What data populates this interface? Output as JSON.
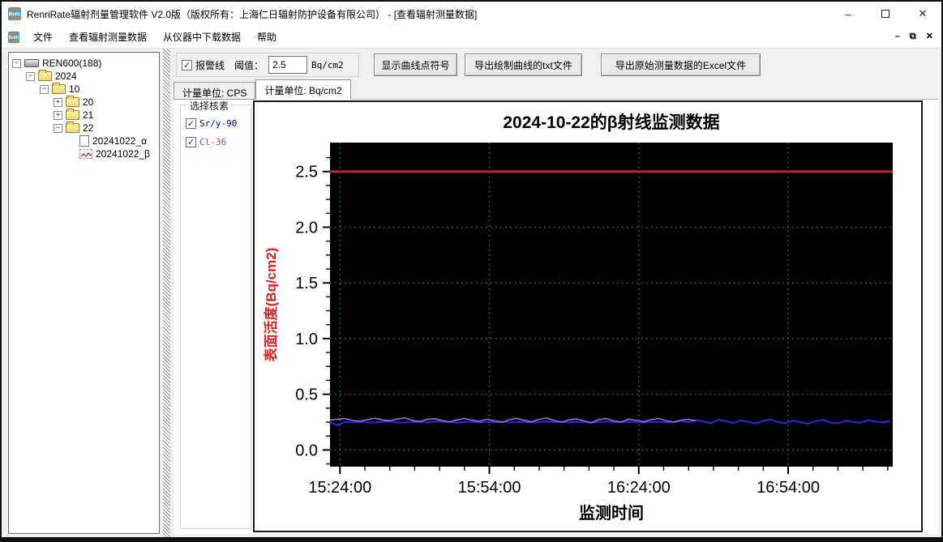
{
  "window": {
    "title": "RenriRate辐射剂量管理软件 V2.0版（版权所有：上海仁日辐射防护设备有限公司） - [查看辐射测量数据]",
    "controls": {
      "minimize": "–",
      "maximize": "",
      "close": "✕"
    }
  },
  "menu": {
    "items": [
      "文件",
      "查看辐射测量数据",
      "从仪器中下载数据",
      "帮助"
    ],
    "mdi_controls": {
      "minimize": "–",
      "restore": "⧉",
      "close": "✕"
    }
  },
  "tree": {
    "items": [
      {
        "label": "REN600(188)",
        "depth": 0,
        "icon": "device",
        "expander": "−"
      },
      {
        "label": "2024",
        "depth": 1,
        "icon": "folder",
        "expander": "−"
      },
      {
        "label": "10",
        "depth": 2,
        "icon": "folder",
        "expander": "−"
      },
      {
        "label": "20",
        "depth": 3,
        "icon": "folder",
        "expander": "+"
      },
      {
        "label": "21",
        "depth": 3,
        "icon": "folder",
        "expander": "+"
      },
      {
        "label": "22",
        "depth": 3,
        "icon": "folder",
        "expander": "−"
      },
      {
        "label": "20241022_α",
        "depth": 4,
        "icon": "doc",
        "expander": ""
      },
      {
        "label": "20241022_β",
        "depth": 4,
        "icon": "chart",
        "expander": ""
      }
    ]
  },
  "toolbar": {
    "alarm_checkbox_label": "报警线",
    "alarm_checked": true,
    "threshold_label": "阈值：",
    "threshold_value": "2.5",
    "threshold_unit": "Bq/cm2",
    "show_points_button": "显示曲线点符号",
    "export_txt_button": "导出绘制曲线的txt文件",
    "export_excel_button": "导出原始测量数据的Excel文件"
  },
  "tabs": [
    {
      "label": "计量单位: CPS",
      "selected": false
    },
    {
      "label": "计量单位: Bq/cm2",
      "selected": true
    }
  ],
  "nuclide_panel": {
    "title": "选择核素",
    "items": [
      {
        "label": "Sr/y-90",
        "checked": true,
        "color": "#00009b"
      },
      {
        "label": "Cl-36",
        "checked": true,
        "color": "#a23ad6"
      }
    ]
  },
  "icons": {
    "check_glyph": "✓"
  },
  "chart_data": {
    "type": "line",
    "title": "2024-10-22的β射线监测数据",
    "xlabel": "监测时间",
    "ylabel": "表面活度(Bq/cm2)",
    "plot_bg": "#000000",
    "grid_color": "#2d8a2d",
    "title_color": "#000000",
    "ylabel_color": "#e02020",
    "x_axis": {
      "ticks": [
        "15:24:00",
        "15:54:00",
        "16:24:00",
        "16:54:00"
      ],
      "tick_minutes": [
        2,
        32,
        62,
        92
      ],
      "domain_minutes": [
        0,
        113
      ],
      "minor_step_min": 5,
      "start_time": "15:22:00"
    },
    "y_axis": {
      "ticks": [
        "0.0",
        "0.5",
        "1.0",
        "1.5",
        "2.0",
        "2.5"
      ],
      "tick_values": [
        0,
        0.5,
        1.0,
        1.5,
        2.0,
        2.5
      ],
      "domain": [
        -0.15,
        2.76
      ],
      "minor_step": 0.125
    },
    "alarm_line": {
      "value": 2.5,
      "color": "#e02020"
    },
    "series": [
      {
        "name": "Sr/y-90",
        "color": "#2626d9",
        "width": 2.2,
        "start_min": 0,
        "step_min": 1.5,
        "values": [
          0.25,
          0.222,
          0.251,
          0.248,
          0.253,
          0.249,
          0.246,
          0.252,
          0.256,
          0.248,
          0.245,
          0.251,
          0.25,
          0.247,
          0.254,
          0.257,
          0.25,
          0.246,
          0.251,
          0.254,
          0.248,
          0.252,
          0.249,
          0.255,
          0.247,
          0.251,
          0.253,
          0.246,
          0.25,
          0.256,
          0.249,
          0.252,
          0.247,
          0.253,
          0.25,
          0.245,
          0.251,
          0.255,
          0.248,
          0.25,
          0.254,
          0.249,
          0.246,
          0.252,
          0.25,
          0.247,
          0.251,
          0.262,
          0.247,
          0.268,
          0.255,
          0.24,
          0.272,
          0.258,
          0.243,
          0.265,
          0.252,
          0.238,
          0.26,
          0.275,
          0.25,
          0.241,
          0.263,
          0.249,
          0.236,
          0.258,
          0.27,
          0.247,
          0.239,
          0.261,
          0.252,
          0.244,
          0.267,
          0.255,
          0.248,
          0.259
        ]
      },
      {
        "name": "Cl-36",
        "color": "#9b6fd8",
        "width": 1.6,
        "start_min": 0,
        "step_min": 1.5,
        "values": [
          0.268,
          0.275,
          0.282,
          0.265,
          0.258,
          0.272,
          0.285,
          0.27,
          0.262,
          0.278,
          0.288,
          0.266,
          0.255,
          0.274,
          0.281,
          0.263,
          0.252,
          0.27,
          0.283,
          0.268,
          0.257,
          0.276,
          0.262,
          0.248,
          0.271,
          0.284,
          0.266,
          0.253,
          0.275,
          0.287,
          0.264,
          0.25,
          0.269,
          0.28,
          0.261,
          0.246,
          0.273,
          0.282,
          0.26,
          0.251,
          0.277,
          0.265,
          0.254,
          0.272,
          0.283,
          0.262,
          0.25,
          0.268,
          0.275,
          0.26
        ]
      }
    ]
  }
}
